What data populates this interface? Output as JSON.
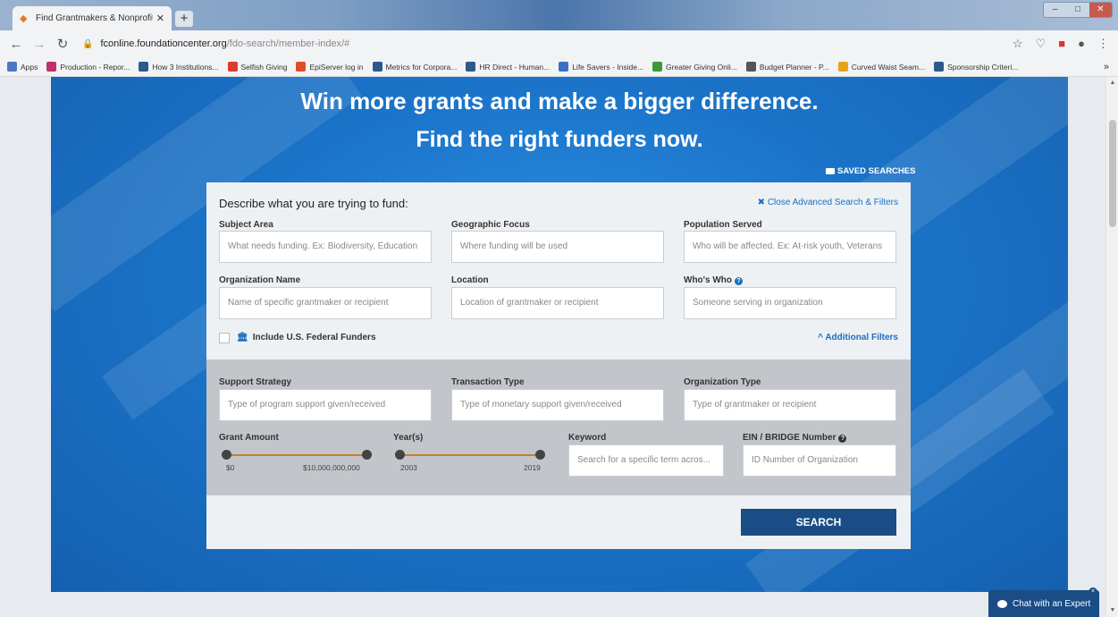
{
  "browser": {
    "tab_title": "Find Grantmakers & Nonprofit F",
    "url_host": "fconline.foundationcenter.org",
    "url_path": "/fdo-search/member-index/#",
    "bookmarks": [
      {
        "label": "Apps",
        "color": "#4a76c4"
      },
      {
        "label": "Production - Repor...",
        "color": "#c0306a"
      },
      {
        "label": "How 3 Institutions...",
        "color": "#2b5a8c"
      },
      {
        "label": "Selfish Giving",
        "color": "#e0392f"
      },
      {
        "label": "EpiServer log in",
        "color": "#e34c26"
      },
      {
        "label": "Metrics for Corpora...",
        "color": "#2b5a8c"
      },
      {
        "label": "HR Direct - Human...",
        "color": "#2b5a8c"
      },
      {
        "label": "Life Savers - Inside...",
        "color": "#3a6fc4"
      },
      {
        "label": "Greater Giving Onli...",
        "color": "#3a9a3a"
      },
      {
        "label": "Budget Planner - P...",
        "color": "#555555"
      },
      {
        "label": "Curved Waist Seam...",
        "color": "#e8a21a"
      },
      {
        "label": "Sponsorship Criteri...",
        "color": "#2b5a8c"
      }
    ]
  },
  "hero": {
    "line1": "Win more grants and make a bigger difference.",
    "line2": "Find the right funders now.",
    "saved_searches": "SAVED SEARCHES"
  },
  "form": {
    "heading": "Describe what you are trying to fund:",
    "close_advanced": "Close Advanced Search & Filters",
    "subject_area": {
      "label": "Subject Area",
      "placeholder": "What needs funding. Ex: Biodiversity, Education"
    },
    "geographic_focus": {
      "label": "Geographic Focus",
      "placeholder": "Where funding will be used"
    },
    "population_served": {
      "label": "Population Served",
      "placeholder": "Who will be affected. Ex: At-risk youth, Veterans"
    },
    "organization_name": {
      "label": "Organization Name",
      "placeholder": "Name of specific grantmaker or recipient"
    },
    "location": {
      "label": "Location",
      "placeholder": "Location of grantmaker or recipient"
    },
    "whos_who": {
      "label": "Who's Who",
      "placeholder": "Someone serving in organization"
    },
    "federal_funders": "Include U.S. Federal Funders",
    "additional_filters": "Additional Filters",
    "support_strategy": {
      "label": "Support Strategy",
      "placeholder": "Type of program support given/received"
    },
    "transaction_type": {
      "label": "Transaction Type",
      "placeholder": "Type of monetary support given/received"
    },
    "organization_type": {
      "label": "Organization Type",
      "placeholder": "Type of grantmaker or recipient"
    },
    "grant_amount": {
      "label": "Grant Amount",
      "min": "$0",
      "max": "$10,000,000,000"
    },
    "years": {
      "label": "Year(s)",
      "min": "2003",
      "max": "2019"
    },
    "keyword": {
      "label": "Keyword",
      "placeholder": "Search for a specific term acros..."
    },
    "ein": {
      "label": "EIN / BRIDGE Number",
      "placeholder": "ID Number of Organization"
    },
    "search_button": "SEARCH"
  },
  "chat": {
    "label": "Chat with an Expert"
  },
  "colors": {
    "accent": "#1b6fc0",
    "button": "#1a4d85",
    "slider": "#c97c2d",
    "hero": "#1b74c9"
  }
}
